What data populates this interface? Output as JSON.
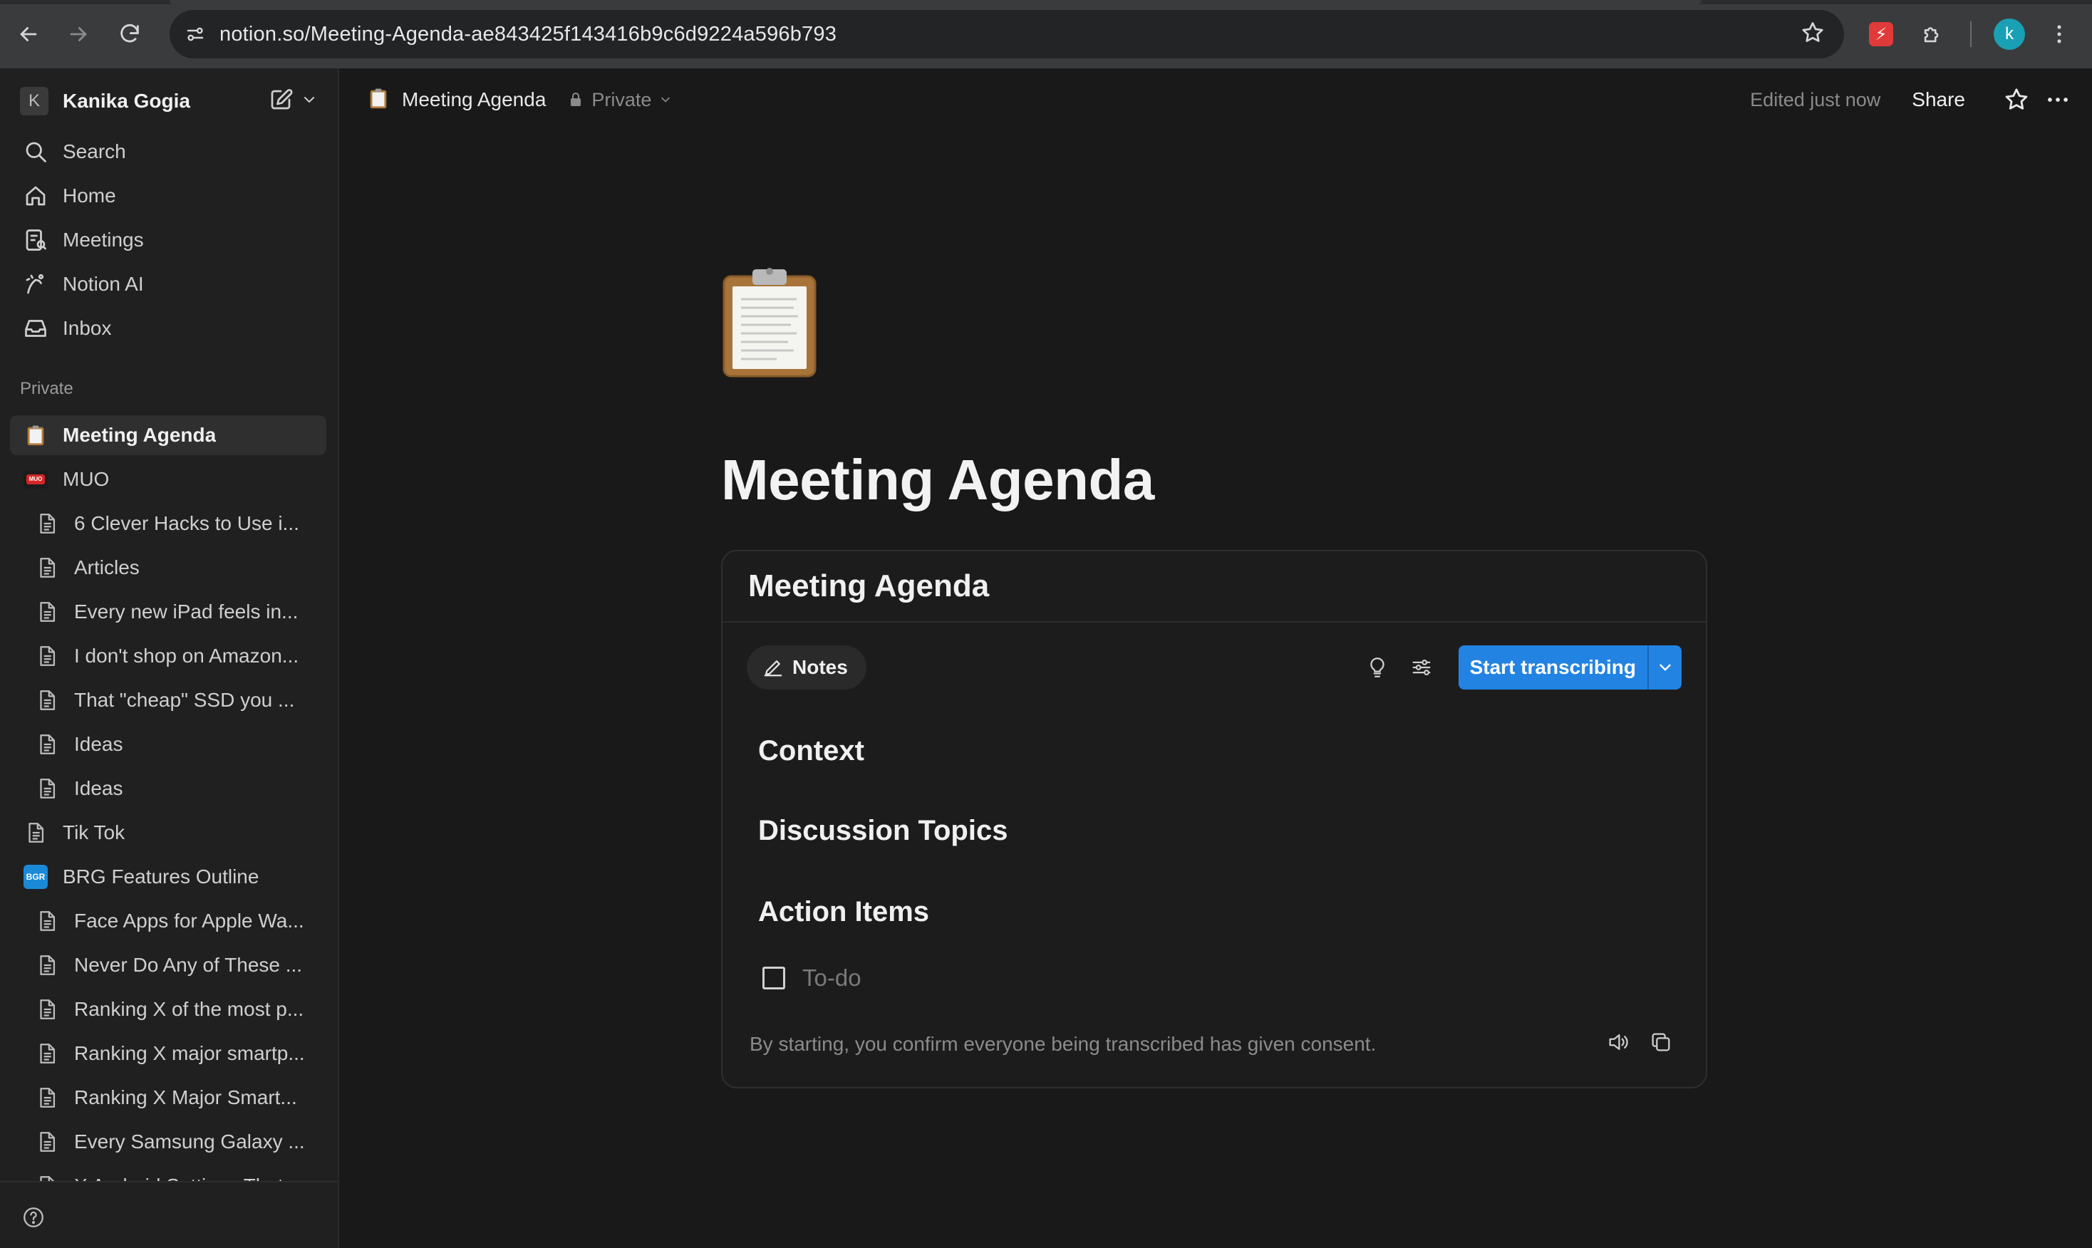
{
  "browser": {
    "url": "notion.so/Meeting-Agenda-ae843425f143416b9c6d9224a596b793",
    "profile_initial": "k",
    "accent_profile": "#1aa0b4"
  },
  "workspace": {
    "initial": "K",
    "name": "Kanika Gogia"
  },
  "sidebar": {
    "nav": [
      {
        "label": "Search",
        "icon": "search-icon"
      },
      {
        "label": "Home",
        "icon": "home-icon"
      },
      {
        "label": "Meetings",
        "icon": "meetings-icon"
      },
      {
        "label": "Notion AI",
        "icon": "notion-ai-icon"
      },
      {
        "label": "Inbox",
        "icon": "inbox-icon"
      }
    ],
    "section_label": "Private",
    "pages": [
      {
        "label": "Meeting Agenda",
        "icon": "clipboard-icon",
        "active": true,
        "level": 0
      },
      {
        "label": "MUO",
        "icon": "muo-logo-icon",
        "level": 0
      },
      {
        "label": "6 Clever Hacks to Use i...",
        "icon": "page-icon",
        "level": 1
      },
      {
        "label": "Articles",
        "icon": "page-icon",
        "level": 1
      },
      {
        "label": "Every new iPad feels in...",
        "icon": "page-icon",
        "level": 1
      },
      {
        "label": "I don't shop on Amazon...",
        "icon": "page-icon",
        "level": 1
      },
      {
        "label": "That \"cheap\" SSD you ...",
        "icon": "page-icon",
        "level": 1
      },
      {
        "label": "Ideas",
        "icon": "page-icon",
        "level": 1
      },
      {
        "label": "Ideas",
        "icon": "page-icon",
        "level": 1
      },
      {
        "label": "Tik Tok",
        "icon": "page-icon",
        "level": 0
      },
      {
        "label": "BRG Features Outline",
        "icon": "bgr-logo-icon",
        "level": 0
      },
      {
        "label": "Face Apps for Apple Wa...",
        "icon": "page-icon",
        "level": 1
      },
      {
        "label": "Never Do Any of These ...",
        "icon": "page-icon",
        "level": 1
      },
      {
        "label": "Ranking X of the most p...",
        "icon": "page-icon",
        "level": 1
      },
      {
        "label": "Ranking X major smartp...",
        "icon": "page-icon",
        "level": 1
      },
      {
        "label": "Ranking X Major Smart...",
        "icon": "page-icon",
        "level": 1
      },
      {
        "label": "Every Samsung Galaxy ...",
        "icon": "page-icon",
        "level": 1
      },
      {
        "label": "X Android Settings That...",
        "icon": "page-icon",
        "level": 1
      }
    ],
    "muo_logo_text": "MUO",
    "bgr_logo_text": "BGR"
  },
  "topbar": {
    "page_title": "Meeting Agenda",
    "privacy": "Private",
    "edited": "Edited just now",
    "share": "Share"
  },
  "page": {
    "icon": "clipboard-icon",
    "title": "Meeting Agenda"
  },
  "meeting_block": {
    "title": "Meeting Agenda",
    "notes_tab": "Notes",
    "start_button": "Start transcribing",
    "accent": "#2383e2",
    "sections": [
      "Context",
      "Discussion Topics",
      "Action Items"
    ],
    "todo_placeholder": "To-do",
    "consent": "By starting, you confirm everyone being transcribed has given consent."
  }
}
